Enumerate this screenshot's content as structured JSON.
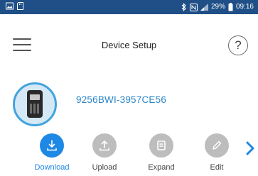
{
  "status_bar": {
    "battery": "29%",
    "time": "09:16",
    "icons": [
      "image-icon",
      "sd-card-icon",
      "bluetooth-icon",
      "nfc-icon",
      "signal-icon",
      "battery-icon"
    ]
  },
  "header": {
    "title": "Device Setup",
    "help_glyph": "?"
  },
  "device": {
    "id": "9256BWI-3957CE56",
    "icon": "handheld-radio-icon"
  },
  "actions": [
    {
      "label": "Download",
      "icon": "download-icon",
      "state": "active"
    },
    {
      "label": "Upload",
      "icon": "upload-icon",
      "state": "disabled"
    },
    {
      "label": "Expand",
      "icon": "expand-icon",
      "state": "disabled"
    },
    {
      "label": "Edit",
      "icon": "edit-icon",
      "state": "disabled"
    }
  ],
  "colors": {
    "status_bar": "#1f4f86",
    "accent": "#1e88e5",
    "device_id": "#2a86c8",
    "disabled": "#bdbdbd"
  }
}
